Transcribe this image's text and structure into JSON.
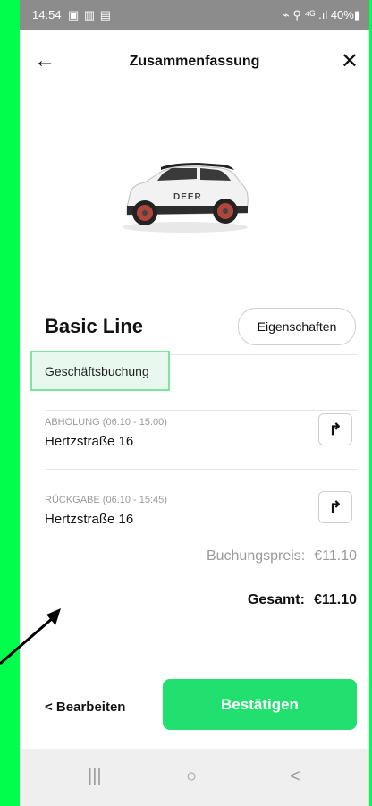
{
  "status_bar": {
    "time": "14:54",
    "icons_left": "▣ ▥ ▤",
    "icons_right": "⌁ ⚲ ⁴ᴳ .ıl 40%▮"
  },
  "header": {
    "title": "Zusammenfassung",
    "back_icon": "←",
    "close_icon": "✕"
  },
  "vehicle": {
    "model_name": "Basic Line",
    "brand_on_car": "DEER"
  },
  "properties_button": {
    "label": "Eigenschaften"
  },
  "booking_type": {
    "label": "Geschäftsbuchung"
  },
  "pickup": {
    "label": "ABHOLUNG (06.10 - 15:00)",
    "address": "Hertzstraße 16",
    "route_icon": "↱"
  },
  "return": {
    "label": "RÜCKGABE (06.10 - 15:45)",
    "address": "Hertzstraße 16",
    "route_icon": "↱"
  },
  "pricing": {
    "booking_price_label": "Buchungspreis:",
    "booking_price_value": "€11.10",
    "total_label": "Gesamt:",
    "total_value": "€11.10"
  },
  "actions": {
    "edit_label": "< Bearbeiten",
    "confirm_label": "Bestätigen"
  },
  "nav": {
    "recents": "|||",
    "home": "○",
    "back": "<"
  },
  "colors": {
    "accent": "#22e070",
    "page_background": "#00ff4c"
  }
}
